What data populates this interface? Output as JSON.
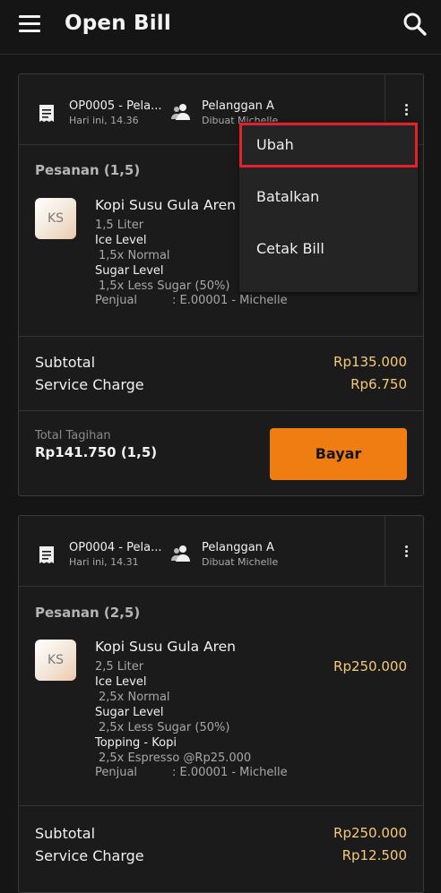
{
  "app_bar": {
    "title": "Open Bill",
    "menu_icon": "hamburger-menu-icon",
    "search_icon": "search-icon"
  },
  "bills": [
    {
      "order_no": "OP0005 - Pela...",
      "time": "Hari ini, 14.36",
      "customer": "Pelanggan A",
      "created_by": "Dibuat Michelle",
      "section_label": "Pesanan (1,5)",
      "item": {
        "initials": "KS",
        "name": "Kopi Susu Gula Aren",
        "qty": "1,5 Liter",
        "ice_level_label": "Ice Level",
        "ice_level_value": "1,5x Normal",
        "sugar_level_label": "Sugar Level",
        "sugar_level_value": "1,5x Less Sugar (50%)",
        "seller_label": "Penjual",
        "seller_value": ": E.00001 - Michelle"
      },
      "subtotal_label": "Subtotal",
      "subtotal_value": "Rp135.000",
      "service_label": "Service Charge",
      "service_value": "Rp6.750",
      "total_label": "Total Tagihan",
      "total_value": "Rp141.750 (1,5)",
      "pay_label": "Bayar"
    },
    {
      "order_no": "OP0004 - Pela...",
      "time": "Hari ini, 14.31",
      "customer": "Pelanggan A",
      "created_by": "Dibuat Michelle",
      "section_label": "Pesanan (2,5)",
      "item": {
        "initials": "KS",
        "name": "Kopi Susu Gula Aren",
        "qty": "2,5 Liter",
        "price": "Rp250.000",
        "ice_level_label": "Ice Level",
        "ice_level_value": "2,5x Normal",
        "sugar_level_label": "Sugar Level",
        "sugar_level_value": "2,5x Less Sugar (50%)",
        "topping_label": "Topping - Kopi",
        "topping_value": "2,5x Espresso @Rp25.000",
        "seller_label": "Penjual",
        "seller_value": ": E.00001 - Michelle"
      },
      "subtotal_label": "Subtotal",
      "subtotal_value": "Rp250.000",
      "service_label": "Service Charge",
      "service_value": "Rp12.500"
    }
  ],
  "dropdown_menu": {
    "items": [
      "Ubah",
      "Batalkan",
      "Cetak Bill"
    ],
    "highlighted": "Ubah"
  },
  "colors": {
    "accent": "#f07d12",
    "price": "#f5c97a",
    "highlight": "#e5202a",
    "background": "#151515"
  }
}
